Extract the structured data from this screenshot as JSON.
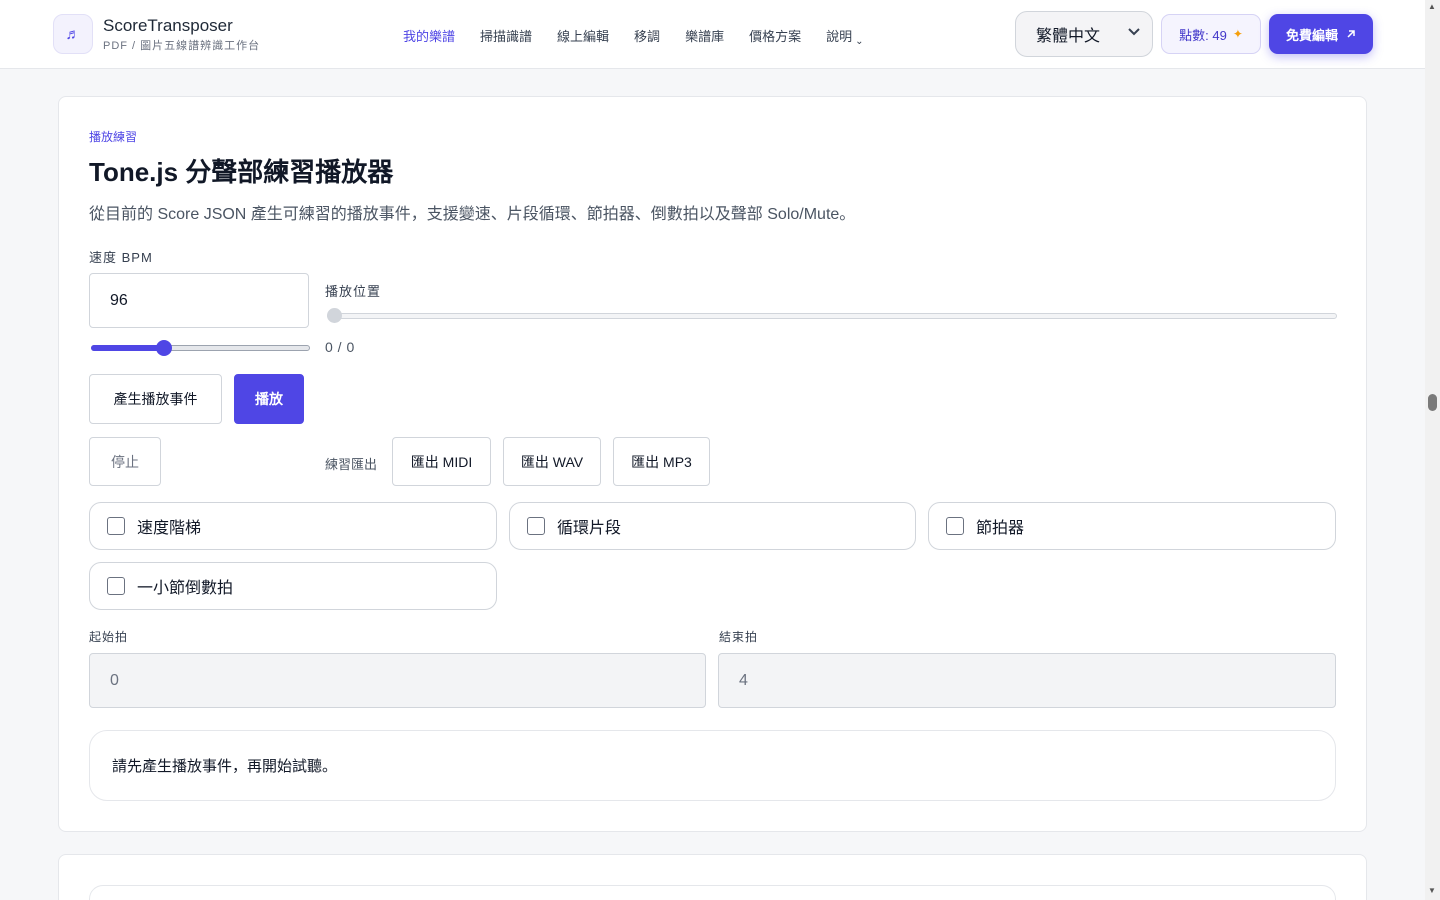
{
  "header": {
    "logo_glyph": "♬",
    "brand_name": "ScoreTransposer",
    "brand_sub": "PDF / 圖片五線譜辨識工作台",
    "nav": [
      {
        "label": "我的樂譜",
        "active": true
      },
      {
        "label": "掃描識譜",
        "active": false
      },
      {
        "label": "線上編輯",
        "active": false
      },
      {
        "label": "移調",
        "active": false
      },
      {
        "label": "樂譜庫",
        "active": false
      },
      {
        "label": "價格方案",
        "active": false
      },
      {
        "label": "說明",
        "active": false,
        "has_dropdown": true
      }
    ],
    "help_chevron": "⌄",
    "language": "繁體中文",
    "credits_label": "點數: 49",
    "credits_icon": "sparkle-icon",
    "cta_label": "免費編輯",
    "cta_icon": "arrow-up-right-icon"
  },
  "player": {
    "eyebrow": "播放練習",
    "title": "Tone.js 分聲部練習播放器",
    "description": "從目前的 Score JSON 產生可練習的播放事件，支援變速、片段循環、節拍器、倒數拍以及聲部 Solo/Mute。",
    "tempo_label": "速度 BPM",
    "tempo_value": "96",
    "tempo_slider_fraction": 0.32,
    "position_label": "播放位置",
    "position_slider_fraction": 0,
    "position_readout": "0 / 0",
    "generate_button": "產生播放事件",
    "play_button": "播放",
    "stop_button": "停止",
    "export_label": "練習匯出",
    "export_midi": "匯出 MIDI",
    "export_wav": "匯出 WAV",
    "export_mp3": "匯出 MP3",
    "options": [
      {
        "label": "速度階梯",
        "checked": false
      },
      {
        "label": "循環片段",
        "checked": false
      },
      {
        "label": "節拍器",
        "checked": false
      },
      {
        "label": "一小節倒數拍",
        "checked": false
      }
    ],
    "start_beat_label": "起始拍",
    "start_beat_value": "0",
    "end_beat_label": "結束拍",
    "end_beat_value": "4",
    "status_text": "請先產生播放事件，再開始試聽。"
  },
  "colors": {
    "accent": "#4f46e5",
    "text": "#111827",
    "muted": "#6b7280"
  }
}
